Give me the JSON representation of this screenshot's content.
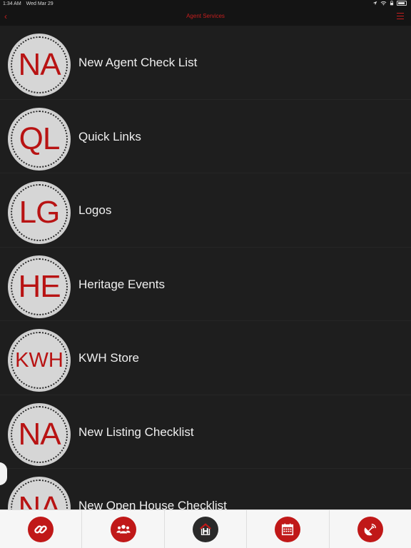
{
  "status_bar": {
    "time": "1:34 AM",
    "date": "Wed Mar 29"
  },
  "nav": {
    "title": "Agent Services",
    "back_glyph": "‹"
  },
  "items": [
    {
      "initials": "NA",
      "label": "New Agent Check List"
    },
    {
      "initials": "QL",
      "label": "Quick Links"
    },
    {
      "initials": "LG",
      "label": "Logos"
    },
    {
      "initials": "HE",
      "label": "Heritage Events"
    },
    {
      "initials": "KWH",
      "label": "KWH Store"
    },
    {
      "initials": "NA",
      "label": "New Listing Checklist"
    },
    {
      "initials": "NA",
      "label": "New Open House Checklist"
    }
  ],
  "tabs": [
    {
      "icon": "link-icon"
    },
    {
      "icon": "people-icon"
    },
    {
      "icon": "home-h-icon"
    },
    {
      "icon": "calendar-icon"
    },
    {
      "icon": "satellite-dish-icon"
    }
  ],
  "colors": {
    "accent": "#c01818",
    "background": "#1e1e1e",
    "tabbar": "#f6f6f6"
  }
}
